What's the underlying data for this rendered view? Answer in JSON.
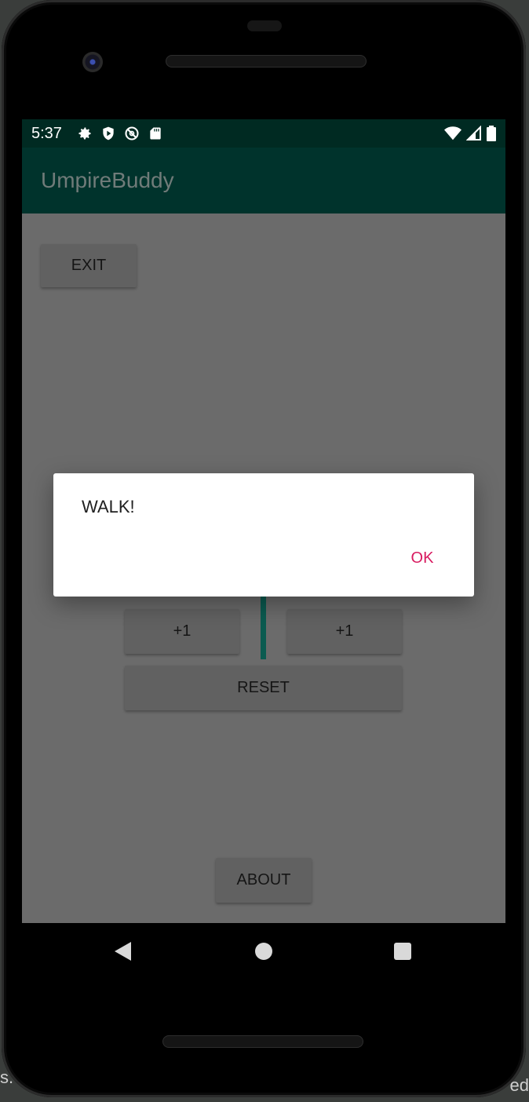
{
  "status_bar": {
    "time": "5:37",
    "left_icons": [
      "settings-gear-icon",
      "play-protect-icon",
      "no-disturb-icon",
      "sd-card-icon"
    ],
    "right_icons": [
      "wifi-icon",
      "signal-icon",
      "battery-icon"
    ]
  },
  "app_bar": {
    "title": "UmpireBuddy"
  },
  "main": {
    "exit_label": "EXIT",
    "plus_left_label": "+1",
    "plus_right_label": "+1",
    "reset_label": "RESET",
    "about_label": "ABOUT"
  },
  "dialog": {
    "message": "WALK!",
    "ok_label": "OK"
  },
  "nav_bar": {
    "icons": [
      "back-icon",
      "home-icon",
      "recents-icon"
    ]
  },
  "background_window": {
    "left_text": "s.",
    "right_text": "ed"
  },
  "colors": {
    "status_bar": "#002a22",
    "app_bar": "#00332c",
    "scrim": "#6b6b6b",
    "dialog_button": "#d81b60",
    "divider": "#0b5b50"
  }
}
